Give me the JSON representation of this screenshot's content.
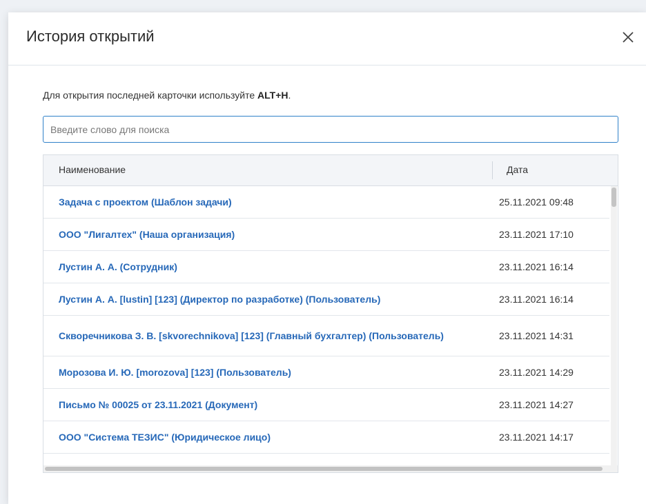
{
  "dialog": {
    "title": "История открытий",
    "hint_prefix": "Для открытия последней карточки используйте ",
    "hint_shortcut": "ALT+H",
    "hint_suffix": ".",
    "search": {
      "placeholder": "Введите слово для поиска",
      "value": ""
    },
    "table": {
      "columns": {
        "name": "Наименование",
        "date": "Дата"
      },
      "rows": [
        {
          "name": "Задача с проектом (Шаблон задачи)",
          "date": "25.11.2021 09:48"
        },
        {
          "name": "ООО \"Лигалтех\" (Наша организация)",
          "date": "23.11.2021 17:10"
        },
        {
          "name": "Лустин А. А. (Сотрудник)",
          "date": "23.11.2021 16:14"
        },
        {
          "name": "Лустин А. А. [lustin] [123] (Директор по разработке) (Пользователь)",
          "date": "23.11.2021 16:14"
        },
        {
          "name": "Скворечникова З. В. [skvorechnikova] [123] (Главный бухгалтер) (Пользователь)",
          "date": "23.11.2021 14:31"
        },
        {
          "name": "Морозова И. Ю. [morozova] [123] (Пользователь)",
          "date": "23.11.2021 14:29"
        },
        {
          "name": "Письмо № 00025 от 23.11.2021 (Документ)",
          "date": "23.11.2021 14:27"
        },
        {
          "name": "ООО \"Система ТЕЗИС\" (Юридическое лицо)",
          "date": "23.11.2021 14:17"
        }
      ]
    }
  },
  "colors": {
    "link": "#2668b8",
    "accent_border": "#2f80c9"
  },
  "icons": {
    "close": "close-icon"
  }
}
